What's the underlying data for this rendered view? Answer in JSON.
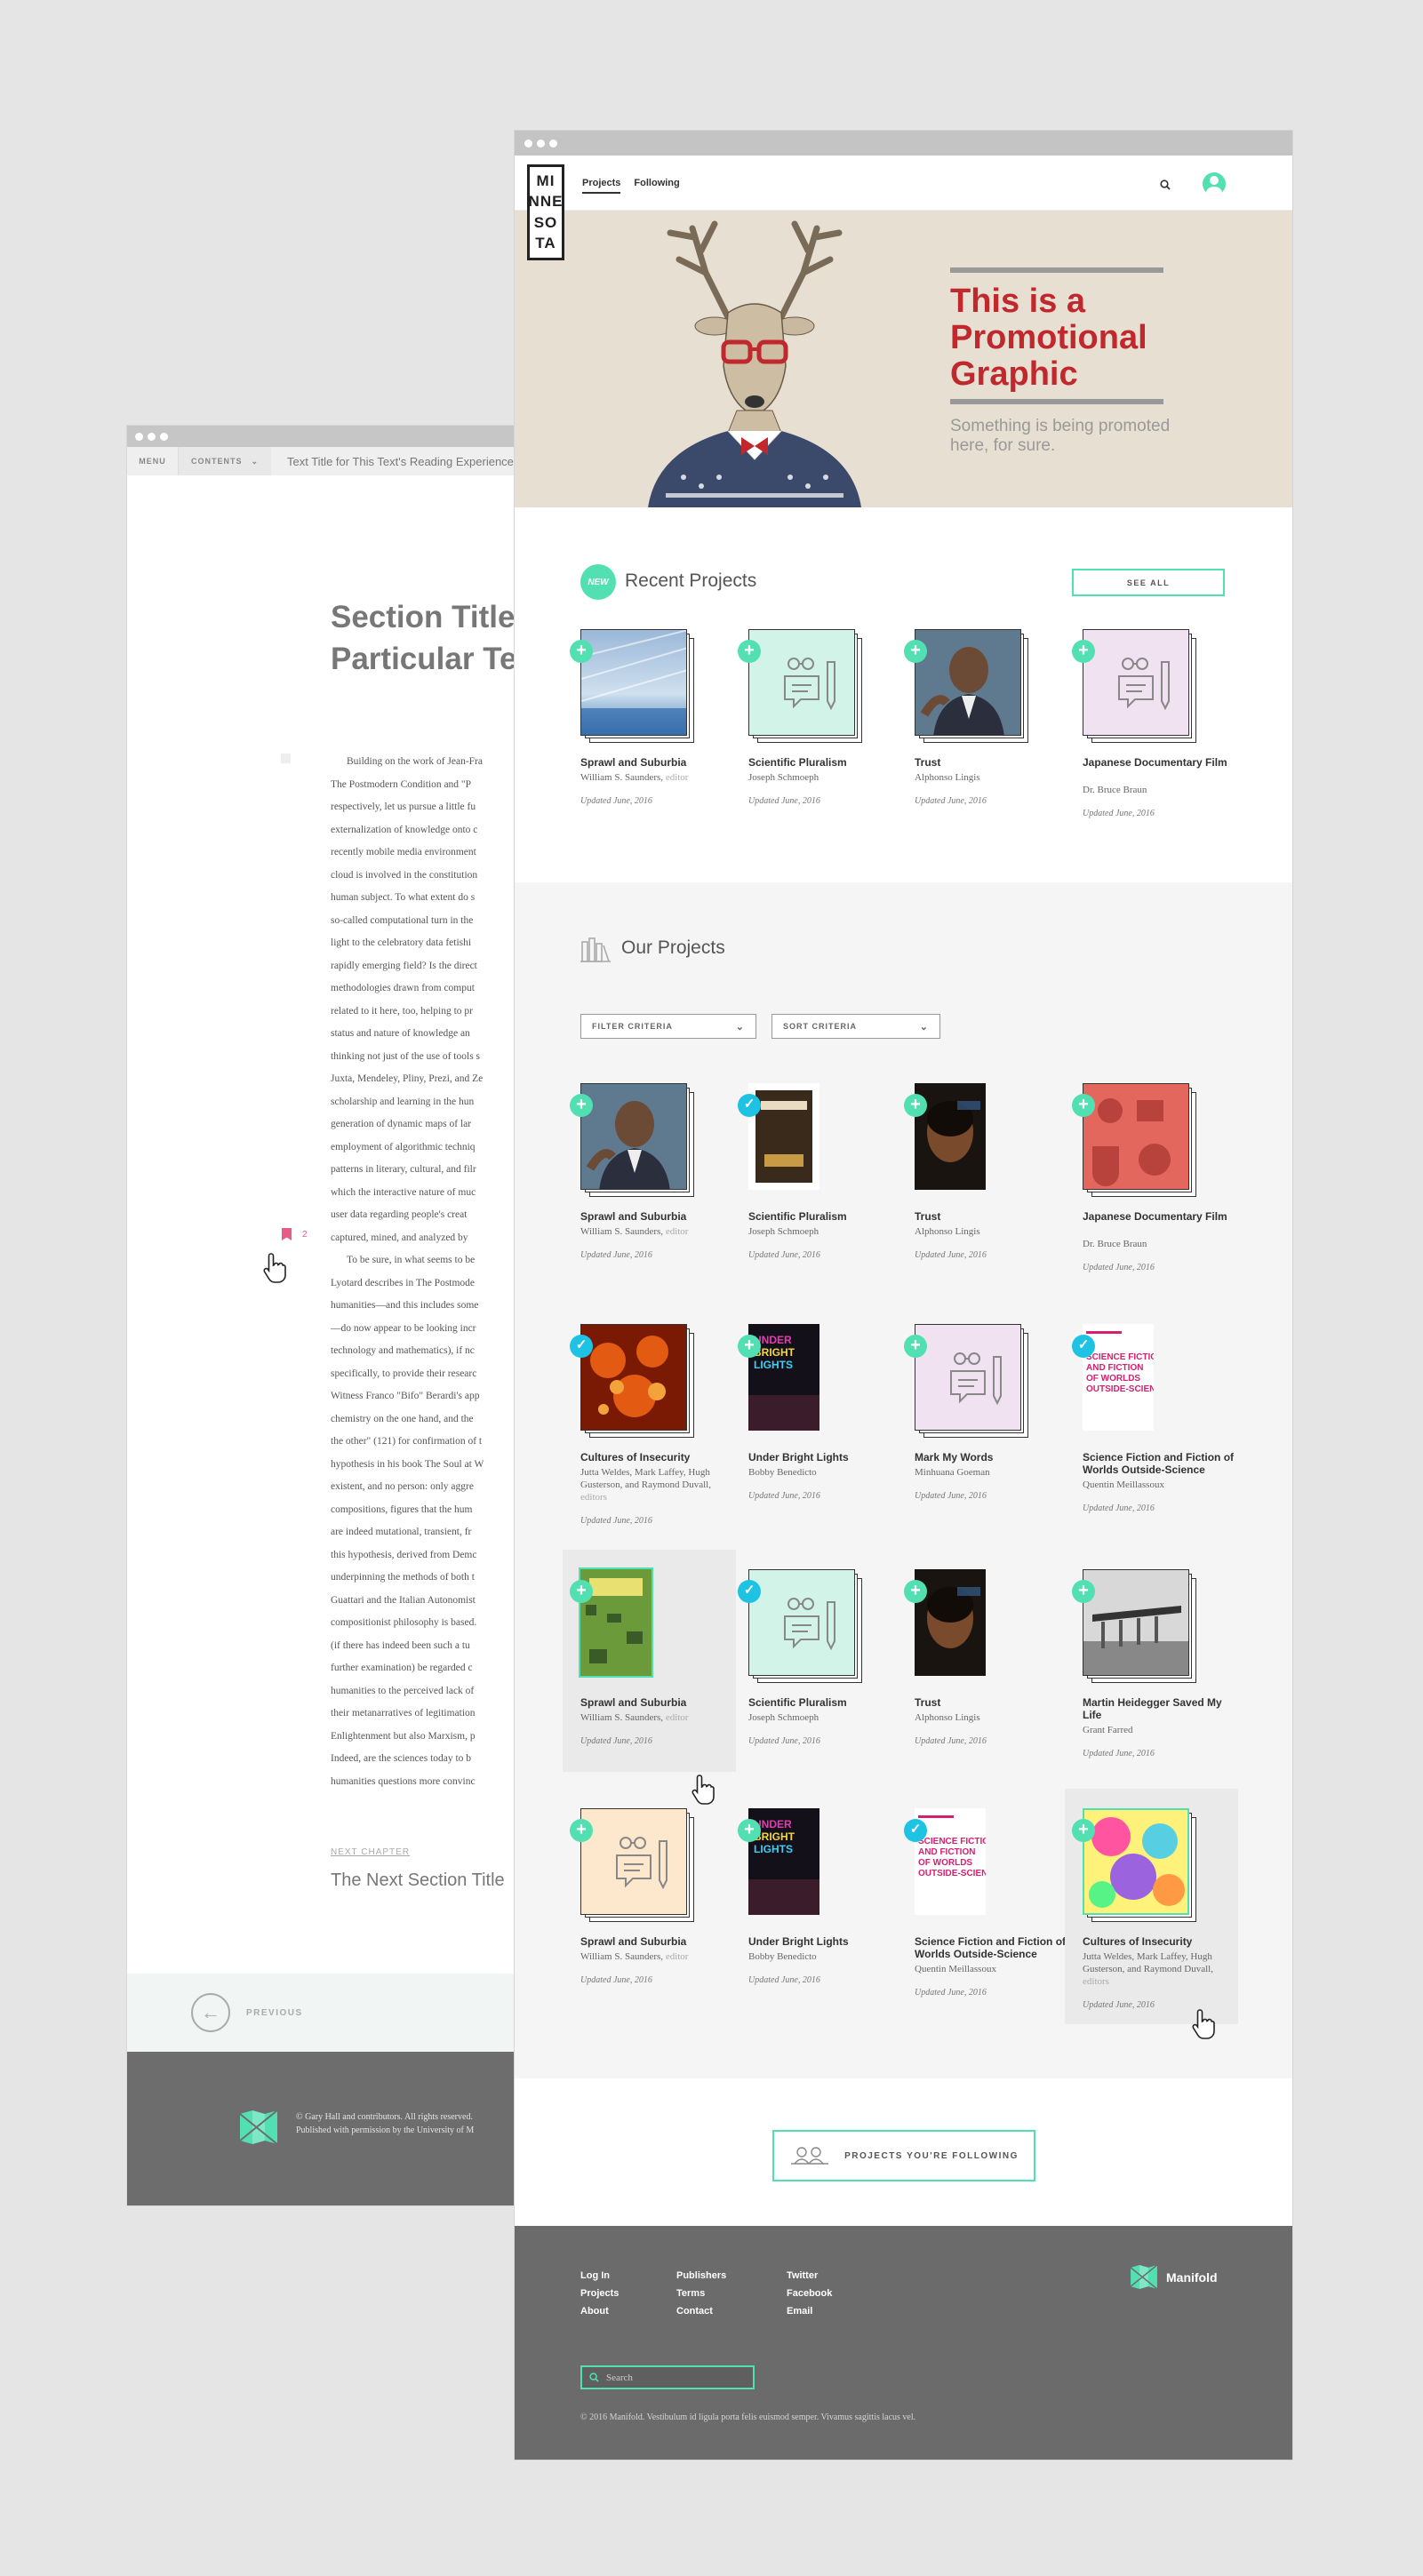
{
  "reader": {
    "menu_label": "MENU",
    "contents_label": "CONTENTS",
    "text_title": "Text Title for This Text's Reading Experience",
    "section_title_1": "Section Title",
    "section_title_2": "Particular Te",
    "paragraph_lines": [
      "Building on the work of Jean-Fra",
      "The Postmodern Condition and \"P",
      "respectively, let us pursue a little fu",
      "externalization of knowledge onto c",
      "recently mobile media environment",
      "cloud is involved in the constitution",
      "human subject. To what extent do s",
      "so-called computational turn in the",
      "light to the celebratory data fetishi",
      "rapidly emerging field? Is the direct",
      "methodologies drawn from comput",
      "related to it here, too, helping to pr",
      "status and nature of knowledge an",
      "thinking not just of the use of tools s",
      "Juxta, Mendeley, Pliny, Prezi, and Ze",
      "scholarship and learning in the hun",
      "generation of dynamic maps of lar",
      "employment of algorithmic techniq",
      "patterns in literary, cultural, and filr",
      "which the interactive nature of muc",
      "user data regarding people's creat",
      "captured, mined, and analyzed by",
      "To be sure, in what seems to be",
      "Lyotard describes in The Postmode",
      "humanities—and this includes some",
      "—do now appear to be looking incr",
      "technology and mathematics), if nc",
      "specifically, to provide their researc",
      "Witness Franco \"Bifo\" Berardi's app",
      "chemistry on the one hand, and the",
      "the other\" (121) for confirmation of t",
      "hypothesis in his book The Soul at W",
      "existent, and no person: only aggre",
      "compositions, figures that the hum",
      "are indeed mutational, transient, fr",
      "this hypothesis, derived from Demc",
      "underpinning the methods of both t",
      "Guattari and the Italian Autonomist",
      "compositionist philosophy is based.",
      "(if there has indeed been such a tu",
      "further examination) be regarded c",
      "humanities to the perceived lack of",
      "their metanarratives of legitimation",
      "Enlightenment but also Marxism, p",
      "Indeed, are the sciences today to b",
      "humanities questions more convinc"
    ],
    "annotation_count": "2",
    "next_chapter_label": "NEXT CHAPTER",
    "next_section_title": "The Next Section Title",
    "previous_label": "PREVIOUS",
    "footer_copy_1": "© Gary Hall and contributors. All rights reserved.",
    "footer_copy_2": "Published with permission by the University of M"
  },
  "main": {
    "logo_letters": [
      "MI",
      "NNE",
      "SO",
      "TA"
    ],
    "nav_tabs": [
      "Projects",
      "Following"
    ],
    "hero": {
      "title": "This is a Promotional Graphic",
      "subtitle": "Something is being promoted here, for sure."
    },
    "recent": {
      "badge": "NEW",
      "heading": "Recent Projects",
      "see_all": "SEE ALL"
    },
    "our": {
      "heading": "Our Projects",
      "filter_label": "FILTER CRITERIA",
      "sort_label": "SORT CRITERIA"
    },
    "following_button": "PROJECTS YOU'RE FOLLOWING",
    "footer": {
      "col1": [
        "Log In",
        "Projects",
        "About"
      ],
      "col2": [
        "Publishers",
        "Terms",
        "Contact"
      ],
      "col3": [
        "Twitter",
        "Facebook",
        "Email"
      ],
      "brand": "Manifold",
      "search_placeholder": "Search",
      "copyright": "© 2016 Manifold. Vestibulum id ligula porta felis euismod semper. Vivamus sagittis lacus vel."
    },
    "recent_projects": [
      {
        "title": "Sprawl and Suburbia",
        "author": "William S. Saunders,",
        "editor": "editor",
        "updated": "Updated June, 2016",
        "cover": "sea",
        "badge": "plus"
      },
      {
        "title": "Scientific Pluralism",
        "author": "Joseph Schmoeph",
        "editor": "",
        "updated": "Updated June, 2016",
        "cover": "green-icon",
        "badge": "plus"
      },
      {
        "title": "Trust",
        "author": "Alphonso Lingis",
        "editor": "",
        "updated": "Updated June, 2016",
        "cover": "man",
        "badge": "plus"
      },
      {
        "title": "Japanese Documentary Film",
        "author": "Dr. Bruce Braun",
        "editor": "",
        "updated": "Updated June, 2016",
        "cover": "pink-icon",
        "badge": "plus"
      }
    ],
    "our_projects": [
      {
        "title": "Sprawl and Suburbia",
        "author": "William S. Saunders,",
        "editor": "editor",
        "updated": "Updated June, 2016",
        "cover": "man",
        "badge": "plus",
        "style": "stack"
      },
      {
        "title": "Scientific Pluralism",
        "author": "Joseph Schmoeph",
        "editor": "",
        "updated": "Updated June, 2016",
        "cover": "book-brown",
        "badge": "check",
        "style": "book"
      },
      {
        "title": "Trust",
        "author": "Alphonso Lingis",
        "editor": "",
        "updated": "Updated June, 2016",
        "cover": "trust",
        "badge": "plus",
        "style": "book"
      },
      {
        "title": "Japanese Documentary Film",
        "author": "Dr. Bruce Braun",
        "editor": "",
        "updated": "Updated June, 2016",
        "cover": "salmon",
        "badge": "plus",
        "style": "stack"
      },
      {
        "title": "Cultures of Insecurity",
        "author": "Jutta Weldes, Mark Laffey, Hugh Gusterson, and Raymond Duvall,",
        "editor": "editors",
        "updated": "Updated June, 2016",
        "cover": "fire",
        "badge": "check",
        "style": "stack"
      },
      {
        "title": "Under Bright Lights",
        "author": "Bobby Benedicto",
        "editor": "",
        "updated": "Updated June, 2016",
        "cover": "bright",
        "badge": "plus",
        "style": "book"
      },
      {
        "title": "Mark My Words",
        "author": "Minhuana Goeman",
        "editor": "",
        "updated": "Updated June, 2016",
        "cover": "pink-icon",
        "badge": "plus",
        "style": "stack"
      },
      {
        "title": "Science Fiction and Fiction of Worlds Outside-Science",
        "author": "Quentin Meillassoux",
        "editor": "",
        "updated": "Updated June, 2016",
        "cover": "scifi",
        "badge": "check",
        "style": "book"
      },
      {
        "title": "Sprawl and Suburbia",
        "author": "William S. Saunders,",
        "editor": "editor",
        "updated": "Updated June, 2016",
        "cover": "sprawl",
        "badge": "plus",
        "style": "book-hl"
      },
      {
        "title": "Scientific Pluralism",
        "author": "Joseph Schmoeph",
        "editor": "",
        "updated": "Updated June, 2016",
        "cover": "green-icon",
        "badge": "check",
        "style": "stack"
      },
      {
        "title": "Trust",
        "author": "Alphonso Lingis",
        "editor": "",
        "updated": "Updated June, 2016",
        "cover": "trust",
        "badge": "plus",
        "style": "book"
      },
      {
        "title": "Martin Heidegger Saved My Life",
        "author": "Grant Farred",
        "editor": "",
        "updated": "Updated June, 2016",
        "cover": "bw",
        "badge": "plus",
        "style": "stack"
      },
      {
        "title": "Sprawl and Suburbia",
        "author": "William S. Saunders,",
        "editor": "editor",
        "updated": "Updated June, 2016",
        "cover": "peach-icon",
        "badge": "plus",
        "style": "stack"
      },
      {
        "title": "Under Bright Lights",
        "author": "Bobby Benedicto",
        "editor": "",
        "updated": "Updated June, 2016",
        "cover": "bright",
        "badge": "plus",
        "style": "book"
      },
      {
        "title": "Science Fiction and Fiction of Worlds Outside-Science",
        "author": "Quentin Meillassoux",
        "editor": "",
        "updated": "Updated June, 2016",
        "cover": "scifi",
        "badge": "check",
        "style": "book"
      },
      {
        "title": "Cultures of Insecurity",
        "author": "Jutta Weldes, Mark Laffey, Hugh Gusterson, and Raymond Duvall,",
        "editor": "editors",
        "updated": "Updated June, 2016",
        "cover": "paint",
        "badge": "plus",
        "style": "stack-hl"
      }
    ],
    "colors": {
      "accent": "#52e0b3",
      "check": "#1ec3e4",
      "hero_red": "#c0282e",
      "footer_gray": "#6b6b6b"
    }
  }
}
